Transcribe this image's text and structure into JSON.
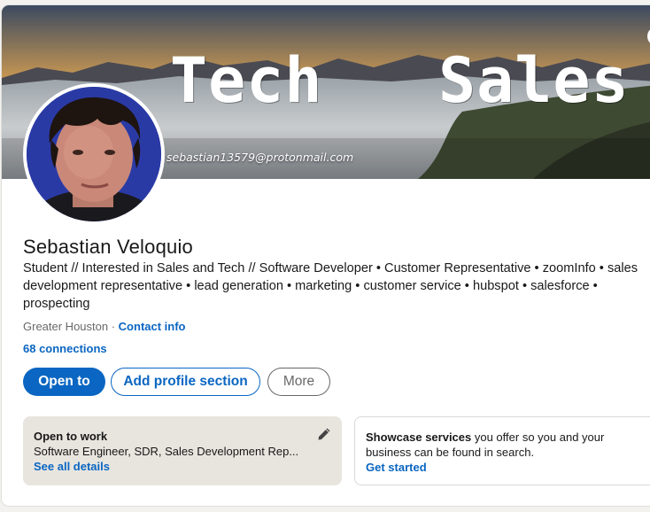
{
  "banner": {
    "word_left": "Tech",
    "word_right": "Sales",
    "email": "sebastian13579@protonmail.com"
  },
  "profile": {
    "name": "Sebastian Veloquio",
    "headline": "Student // Interested in Sales and Tech // Software Developer • Customer Representative • zoomInfo • sales development representative • lead generation • marketing • customer service • hubspot • salesforce • prospecting",
    "location": "Greater Houston",
    "separator": " · ",
    "contact_label": "Contact info",
    "connections": "68 connections"
  },
  "actions": {
    "open_to": "Open to",
    "add_section": "Add profile section",
    "more": "More"
  },
  "open_to_work": {
    "title": "Open to work",
    "roles": "Software Engineer, SDR, Sales Development Rep...",
    "link": "See all details",
    "edit_icon": "pencil-icon"
  },
  "showcase": {
    "bold": "Showcase services",
    "rest": " you offer so you and your business can be found in search.",
    "link": "Get started"
  },
  "colors": {
    "accent": "#0a66c2",
    "page_bg": "#f3f2ef",
    "open_to_work_bg": "#e8e5df"
  }
}
